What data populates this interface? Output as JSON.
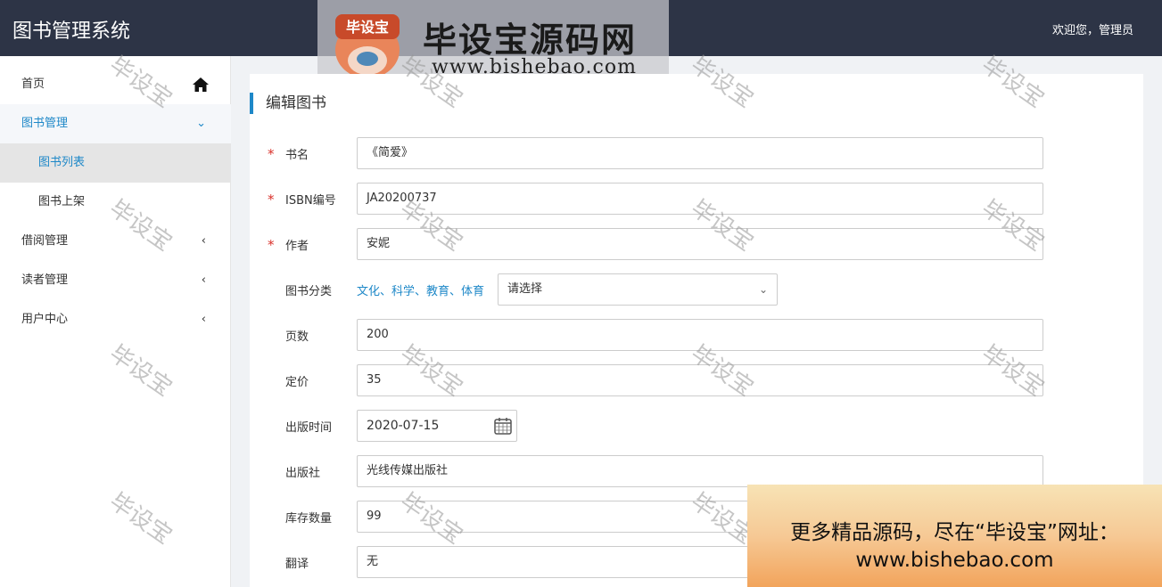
{
  "header": {
    "app_title": "图书管理系统",
    "welcome": "欢迎您，管理员"
  },
  "logo": {
    "name": "毕设宝源码网",
    "badge": "毕设宝",
    "url": "www.bishebao.com"
  },
  "sidebar": {
    "items": [
      {
        "label": "首页",
        "icon": "home-icon"
      },
      {
        "label": "图书管理",
        "icon": "chevron-down-icon"
      },
      {
        "label": "图书列表"
      },
      {
        "label": "图书上架"
      },
      {
        "label": "借阅管理",
        "icon": "chevron-left-icon"
      },
      {
        "label": "读者管理",
        "icon": "chevron-left-icon"
      },
      {
        "label": "用户中心",
        "icon": "chevron-left-icon"
      }
    ]
  },
  "form": {
    "title": "编辑图书",
    "fields": {
      "name": {
        "label": "书名",
        "value": "《简爱》"
      },
      "isbn": {
        "label": "ISBN编号",
        "value": "JA20200737"
      },
      "author": {
        "label": "作者",
        "value": "安妮"
      },
      "category": {
        "label": "图书分类",
        "selected_text": "文化、科学、教育、体育",
        "select_value": "请选择"
      },
      "pages": {
        "label": "页数",
        "value": "200"
      },
      "price": {
        "label": "定价",
        "value": "35"
      },
      "pub_date": {
        "label": "出版时间",
        "value": "2020-07-15"
      },
      "publisher": {
        "label": "出版社",
        "value": "光线传媒出版社"
      },
      "stock": {
        "label": "库存数量",
        "value": "99"
      },
      "translator": {
        "label": "翻译",
        "value": "无"
      }
    }
  },
  "watermark_text": "毕设宝",
  "ad": {
    "line1": "更多精品源码，尽在“毕设宝”网址：",
    "line2": "www.bishebao.com"
  },
  "colors": {
    "topbar": "#2d3446",
    "accent": "#1e88c8",
    "required": "#d9302a"
  }
}
